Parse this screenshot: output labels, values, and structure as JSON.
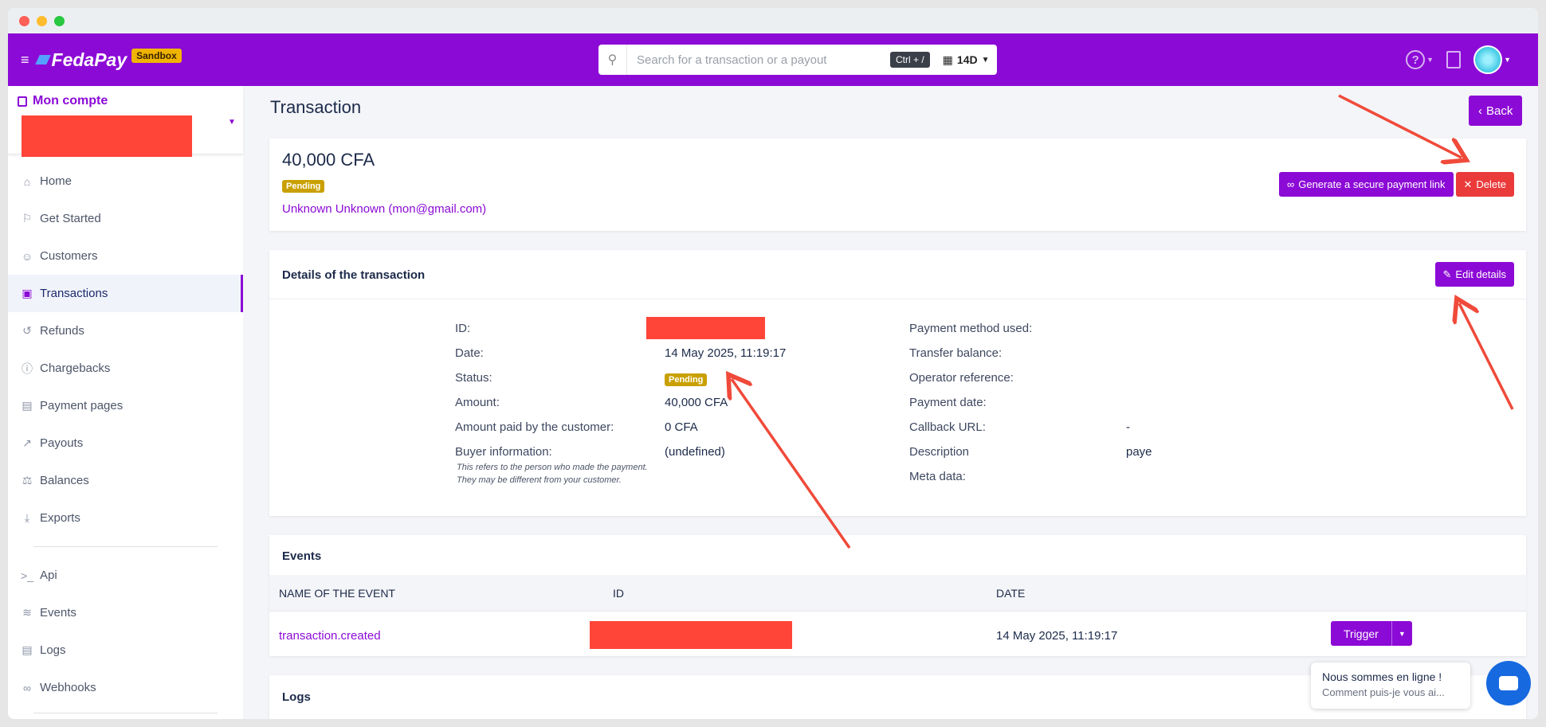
{
  "topnav": {
    "brand": "FedaPay",
    "env_badge": "Sandbox",
    "search_placeholder": "Search for a transaction or a payout",
    "shortcut": "Ctrl + /",
    "period": "14D"
  },
  "sidebar": {
    "account_title": "Mon compte",
    "items": [
      {
        "label": "Home",
        "icon": "home-icon"
      },
      {
        "label": "Get Started",
        "icon": "flag-icon"
      },
      {
        "label": "Customers",
        "icon": "user-circle-icon"
      },
      {
        "label": "Transactions",
        "icon": "money-icon",
        "active": true
      },
      {
        "label": "Refunds",
        "icon": "refund-icon"
      },
      {
        "label": "Chargebacks",
        "icon": "info-icon"
      },
      {
        "label": "Payment pages",
        "icon": "document-icon"
      },
      {
        "label": "Payouts",
        "icon": "external-link-icon"
      },
      {
        "label": "Balances",
        "icon": "scale-icon"
      },
      {
        "label": "Exports",
        "icon": "download-icon"
      }
    ],
    "dev_items": [
      {
        "label": "Api",
        "icon": "terminal-icon"
      },
      {
        "label": "Events",
        "icon": "wifi-icon"
      },
      {
        "label": "Logs",
        "icon": "file-icon"
      },
      {
        "label": "Webhooks",
        "icon": "link-icon"
      }
    ]
  },
  "page": {
    "title": "Transaction",
    "back_label": "Back"
  },
  "summary": {
    "amount": "40,000 CFA",
    "status": "Pending",
    "customer": "Unknown Unknown (mon@gmail.com)",
    "generate_link_label": "Generate a secure payment link",
    "delete_label": "Delete"
  },
  "details": {
    "title": "Details of the transaction",
    "edit_label": "Edit details",
    "left": [
      {
        "label": "ID:",
        "value": ""
      },
      {
        "label": "Date:",
        "value": "14 May 2025, 11:19:17"
      },
      {
        "label": "Status:",
        "value": "Pending"
      },
      {
        "label": "Amount:",
        "value": "40,000 CFA"
      },
      {
        "label": "Amount paid by the customer:",
        "value": "0 CFA"
      },
      {
        "label": "Buyer information:",
        "value": "(undefined)"
      }
    ],
    "buyer_note_1": "This refers to the person who made the payment.",
    "buyer_note_2": "They may be different from your customer.",
    "right": [
      {
        "label": "Payment method used:",
        "value": ""
      },
      {
        "label": "Transfer balance:",
        "value": ""
      },
      {
        "label": "Operator reference:",
        "value": ""
      },
      {
        "label": "Payment date:",
        "value": ""
      },
      {
        "label": "Callback URL:",
        "value": "-"
      },
      {
        "label": "Description",
        "value": "paye"
      },
      {
        "label": "Meta data:",
        "value": ""
      }
    ]
  },
  "events": {
    "title": "Events",
    "columns": [
      "NAME OF THE EVENT",
      "ID",
      "DATE"
    ],
    "rows": [
      {
        "name": "transaction.created",
        "id": "",
        "date": "14 May 2025, 11:19:17"
      }
    ],
    "trigger_label": "Trigger"
  },
  "logs": {
    "title": "Logs"
  },
  "chat": {
    "title": "Nous sommes en ligne !",
    "subtitle": "Comment puis-je vous ai..."
  },
  "colors": {
    "brand": "#8c0ad6",
    "pending": "#c9a000",
    "danger": "#ea3a3a",
    "annotation": "#f04a3a"
  }
}
